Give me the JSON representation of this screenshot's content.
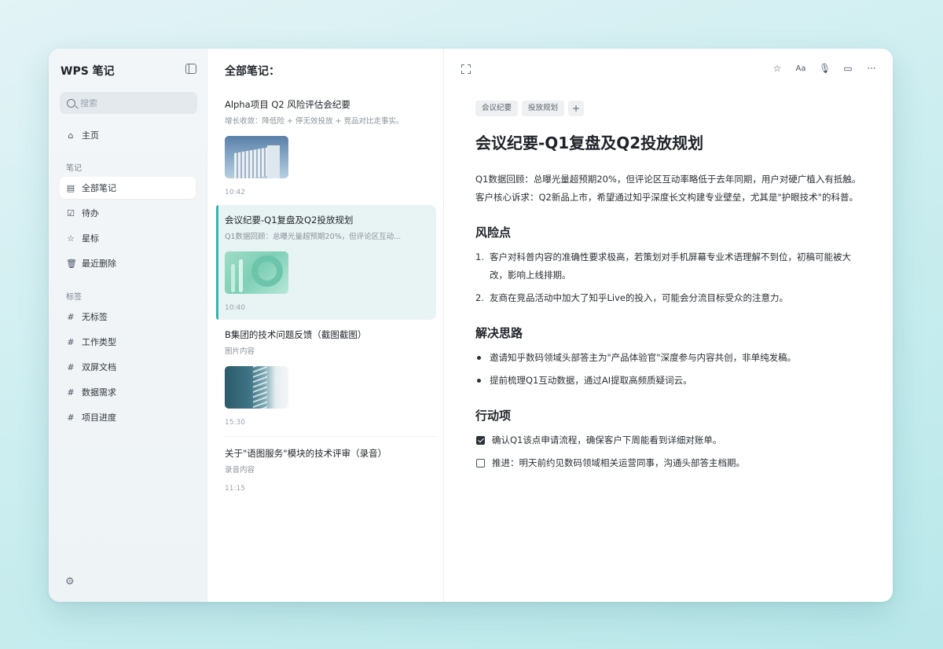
{
  "app": {
    "title": "WPS 笔记"
  },
  "sidebar": {
    "search_placeholder": "搜索",
    "home": "主页",
    "notes_section": "笔记",
    "notes_items": [
      {
        "label": "全部笔记",
        "icon": "note-icon"
      },
      {
        "label": "待办",
        "icon": "todo-icon"
      },
      {
        "label": "星标",
        "icon": "star-icon"
      },
      {
        "label": "最近删除",
        "icon": "trash-icon"
      }
    ],
    "tags_section": "标签",
    "tag_items": [
      "无标签",
      "工作类型",
      "双屏文档",
      "数据需求",
      "项目进度"
    ]
  },
  "list": {
    "title": "全部笔记：",
    "notes": [
      {
        "title": "Alpha项目 Q2 风险评估会纪要",
        "snippet": "增长收敛：降低险 + 停无效投放 + 竞品对比走事实。",
        "time": "10:42",
        "thumb": "building"
      },
      {
        "title": "会议纪要-Q1复盘及Q2投放规划",
        "snippet": "Q1数据回顾：总曝光量超预期20%，但评论区互动...",
        "time": "10:40",
        "thumb": "green"
      },
      {
        "title": "B集团的技术问题反馈（截图截图）",
        "snippet": "图片内容",
        "time": "15:30",
        "thumb": "ocean"
      },
      {
        "title": "关于\"语图服务\"模块的技术评审（录音）",
        "snippet": "录音内容",
        "time": "11:15",
        "thumb": ""
      }
    ]
  },
  "editor": {
    "tags": [
      "会议纪要",
      "投放规划"
    ],
    "tag_add": "+",
    "toolbar": {
      "font": "Aa"
    },
    "title": "会议纪要-Q1复盘及Q2投放规划",
    "paragraphs": [
      "Q1数据回顾：总曝光量超预期20%，但评论区互动率略低于去年同期，用户对硬广植入有抵触。",
      "客户核心诉求：Q2新品上市，希望通过知乎深度长文构建专业壁垒，尤其是\"护眼技术\"的科普。"
    ],
    "section1": "风险点",
    "risks": [
      "客户对科普内容的准确性要求极高，若策划对手机屏幕专业术语理解不到位，初稿可能被大改，影响上线排期。",
      "友商在竞品活动中加大了知乎Live的投入，可能会分流目标受众的注意力。"
    ],
    "section2": "解决思路",
    "solutions": [
      "邀请知乎数码领域头部答主为\"产品体验官\"深度参与内容共创，非单纯发稿。",
      "提前梳理Q1互动数据，通过AI提取高频质疑词云。"
    ],
    "section3": "行动项",
    "todos": [
      {
        "text": "确认Q1该点申请流程，确保客户下周能看到详细对账单。",
        "checked": true
      },
      {
        "text": "推进：明天前约见数码领域相关运营同事，沟通头部答主档期。",
        "checked": false
      }
    ]
  }
}
